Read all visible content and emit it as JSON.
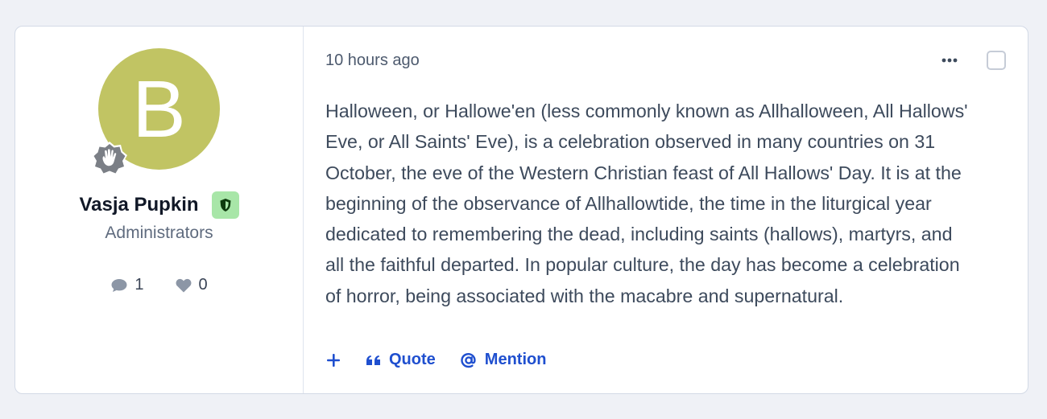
{
  "author": {
    "avatar_letter": "B",
    "avatar_color": "#c1c463",
    "name": "Vasja Pupkin",
    "group": "Administrators",
    "badge_color": "#a8e6a8",
    "badge_icon": "shield-icon",
    "rank_icon": "wave-hand-icon",
    "stats": {
      "posts": "1",
      "likes": "0"
    }
  },
  "post": {
    "time": "10 hours ago",
    "lines": [
      "Halloween, or Hallowe'en (less commonly known as Allhalloween, All Hallows'",
      "Eve, or All Saints' Eve), is a celebration observed in many countries on 31",
      "October, the eve of the Western Christian feast of All Hallows' Day. It is at the",
      "beginning of the observance of Allhallowtide, the time in the liturgical year",
      "dedicated to remembering the dead, including saints (hallows), martyrs, and",
      "all the faithful departed. In popular culture, the day has become a celebration",
      "of horror, being associated with the macabre and supernatural."
    ]
  },
  "actions": {
    "add_label": "+",
    "quote_label": "Quote",
    "mention_label": "Mention",
    "color": "#1f4fcf"
  }
}
